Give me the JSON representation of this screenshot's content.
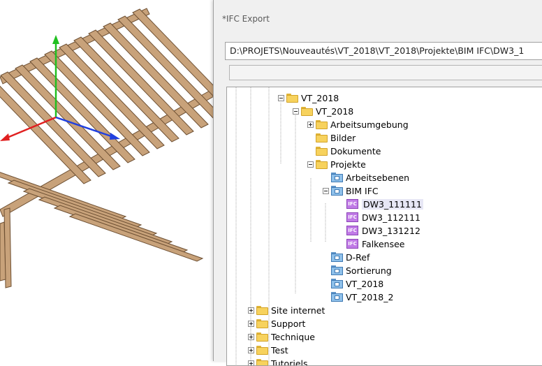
{
  "dialog": {
    "title": "*IFC Export",
    "path": "D:\\PROJETS\\Nouveautés\\VT_2018\\VT_2018\\Projekte\\BIM IFC\\DW3_1"
  },
  "tree": {
    "vt_2018_a": "VT_2018",
    "vt_2018_b": "VT_2018",
    "arbeitsumgebung": "Arbeitsumgebung",
    "bilder": "Bilder",
    "dokumente": "Dokumente",
    "projekte": "Projekte",
    "arbeitsebenen": "Arbeitsebenen",
    "bim_ifc": "BIM IFC",
    "dw3_111111": "DW3_111111",
    "dw3_112111": "DW3_112111",
    "dw3_131212": "DW3_131212",
    "falkensee": "Falkensee",
    "d_ref": "D-Ref",
    "sortierung": "Sortierung",
    "vt_2018_c": "VT_2018",
    "vt_2018_2": "VT_2018_2",
    "site_internet": "Site internet",
    "support": "Support",
    "technique": "Technique",
    "test": "Test",
    "tutoriels": "Tutoriels",
    "ifc_icon_text": "IFC"
  },
  "colors": {
    "timber": "#c8a27a",
    "timber_dark": "#6e5033",
    "axis_x": "#e02020",
    "axis_y": "#20c020",
    "axis_z": "#2040e0"
  }
}
